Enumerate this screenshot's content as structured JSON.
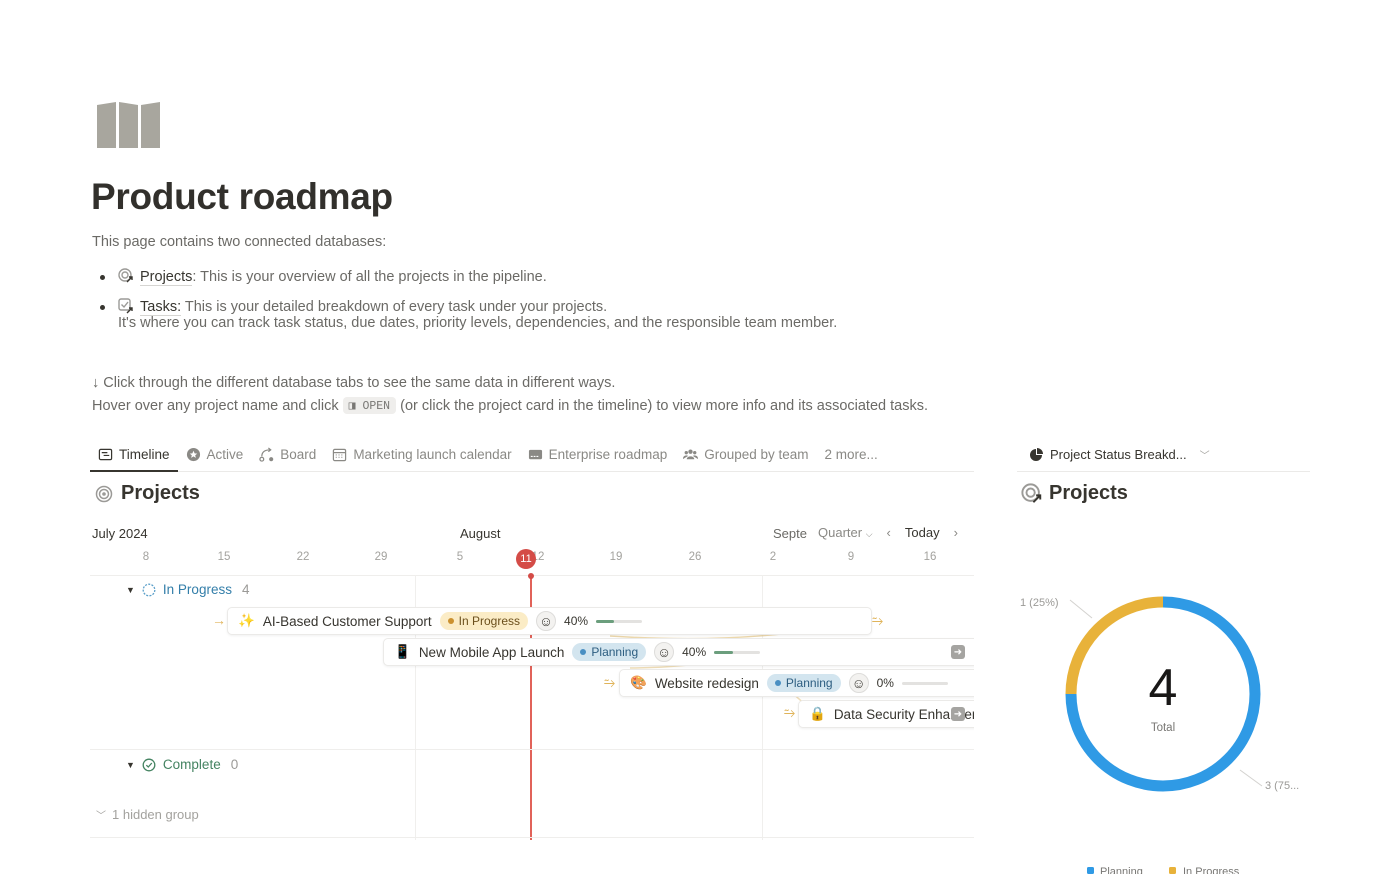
{
  "page": {
    "icon": "map-icon",
    "title": "Product roadmap",
    "intro": "This page contains two connected databases:",
    "bullets": [
      {
        "icon": "projects-db-icon",
        "link": "Projects",
        "text": ": This is your overview of all the projects in the pipeline."
      },
      {
        "icon": "tasks-db-icon",
        "link": "Tasks:",
        "text": " This is your detailed breakdown of every task under your projects."
      }
    ],
    "bullet_continuation": "It's where you can track task status, due dates, priority levels, dependencies, and the responsible team member.",
    "hint_line1": "↓ Click through the different database tabs to see the same data in different ways.",
    "hint_line2_pre": "Hover over any project name and click",
    "hint_kbd": "◨ OPEN",
    "hint_line2_post": "(or click the project card in the timeline) to view more info and its associated tasks."
  },
  "tabs": [
    {
      "label": "Timeline",
      "icon": "timeline-icon",
      "active": true
    },
    {
      "label": "Active",
      "icon": "star-badge-icon",
      "active": false
    },
    {
      "label": "Board",
      "icon": "board-icon",
      "active": false
    },
    {
      "label": "Marketing launch calendar",
      "icon": "calendar-icon",
      "active": false
    },
    {
      "label": "Enterprise roadmap",
      "icon": "card-icon",
      "active": false
    },
    {
      "label": "Grouped by team",
      "icon": "team-icon",
      "active": false
    },
    {
      "label": "2 more...",
      "icon": "",
      "active": false
    }
  ],
  "timeline": {
    "db_title": "Projects",
    "months": [
      "July 2024",
      "August",
      "Septe"
    ],
    "days": [
      "8",
      "15",
      "22",
      "29",
      "5",
      "12",
      "19",
      "26",
      "2",
      "9",
      "16"
    ],
    "today": "11",
    "scale": "Quarter",
    "today_btn": "Today",
    "groups": [
      {
        "name": "In Progress",
        "count": "4",
        "color": "#337ea9"
      },
      {
        "name": "Complete",
        "count": "0",
        "color": "#448361"
      }
    ],
    "hidden_groups": "1 hidden group",
    "items": [
      {
        "emoji": "✨",
        "name": "AI-Based Customer Support",
        "status": "In Progress",
        "progress": "40%",
        "progress_value": 0.4
      },
      {
        "emoji": "📱",
        "name": "New Mobile App Launch",
        "status": "Planning",
        "progress": "40%",
        "progress_value": 0.4
      },
      {
        "emoji": "🎨",
        "name": "Website redesign",
        "status": "Planning",
        "progress": "0%",
        "progress_value": 0
      },
      {
        "emoji": "🔒",
        "name": "Data Security Enhancement",
        "status": "",
        "progress": "",
        "progress_value": null
      }
    ],
    "status_colors": {
      "In Progress": {
        "bg": "#fbecc6",
        "dot": "#cb912f",
        "text": "#6b4f1c"
      },
      "Planning": {
        "bg": "#d3e5ef",
        "dot": "#4a8fc2",
        "text": "#2c5d80"
      }
    }
  },
  "side": {
    "view_label": "Project Status Breakd...",
    "db_title": "Projects"
  },
  "chart_data": {
    "type": "pie",
    "variant": "donut",
    "total": "4",
    "total_label": "Total",
    "slices": [
      {
        "name": "Planning",
        "value": 3,
        "label": "3 (75...",
        "color": "#2f9ae5"
      },
      {
        "name": "In Progress",
        "value": 1,
        "label": "1 (25%)",
        "color": "#e8b23a"
      }
    ],
    "legend": [
      "Planning",
      "In Progress"
    ],
    "legend_position": "bottom"
  }
}
